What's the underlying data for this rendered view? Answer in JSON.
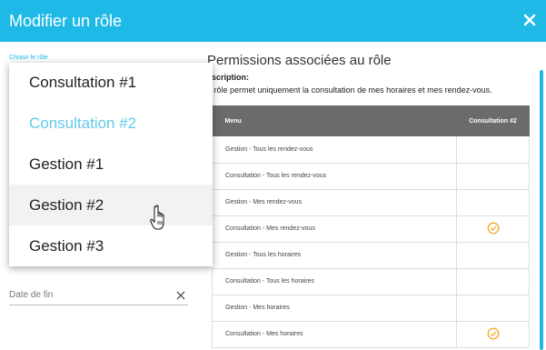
{
  "dialog": {
    "title": "Modifier un rôle",
    "close_icon": "close-icon"
  },
  "role_select": {
    "label": "Choisir le rôle",
    "selected": "Consultation #2",
    "hovered": "Gestion #2",
    "options": [
      "Consultation #1",
      "Consultation #2",
      "Gestion #1",
      "Gestion #2",
      "Gestion #3"
    ]
  },
  "end_date": {
    "placeholder": "Date de fin",
    "clear_icon": "clear-icon"
  },
  "permissions": {
    "title": "Permissions associées au rôle",
    "description_label": "escription:",
    "description_text": "e rôle permet uniquement la consultation de mes horaires et mes rendez-vous.",
    "table": {
      "headers": [
        "Menu",
        "Consultation #2"
      ],
      "rows": [
        {
          "menu": "Gestion - Tous les rendez-vous",
          "checked": false
        },
        {
          "menu": "Consultation - Tous les rendez-vous",
          "checked": false
        },
        {
          "menu": "Gestion - Mes rendez-vous",
          "checked": false
        },
        {
          "menu": "Consultation - Mes rendez-vous",
          "checked": true
        },
        {
          "menu": "Gestion - Tous les horaires",
          "checked": false
        },
        {
          "menu": "Consultation - Tous les horaires",
          "checked": false
        },
        {
          "menu": "Gestion - Mes horaires",
          "checked": false
        },
        {
          "menu": "Consultation - Mes horaires",
          "checked": true
        }
      ]
    }
  },
  "colors": {
    "accent": "#1fb9e8",
    "selected_option": "#62c9ea",
    "check": "#f5a623",
    "table_header": "#6b6b6b"
  }
}
